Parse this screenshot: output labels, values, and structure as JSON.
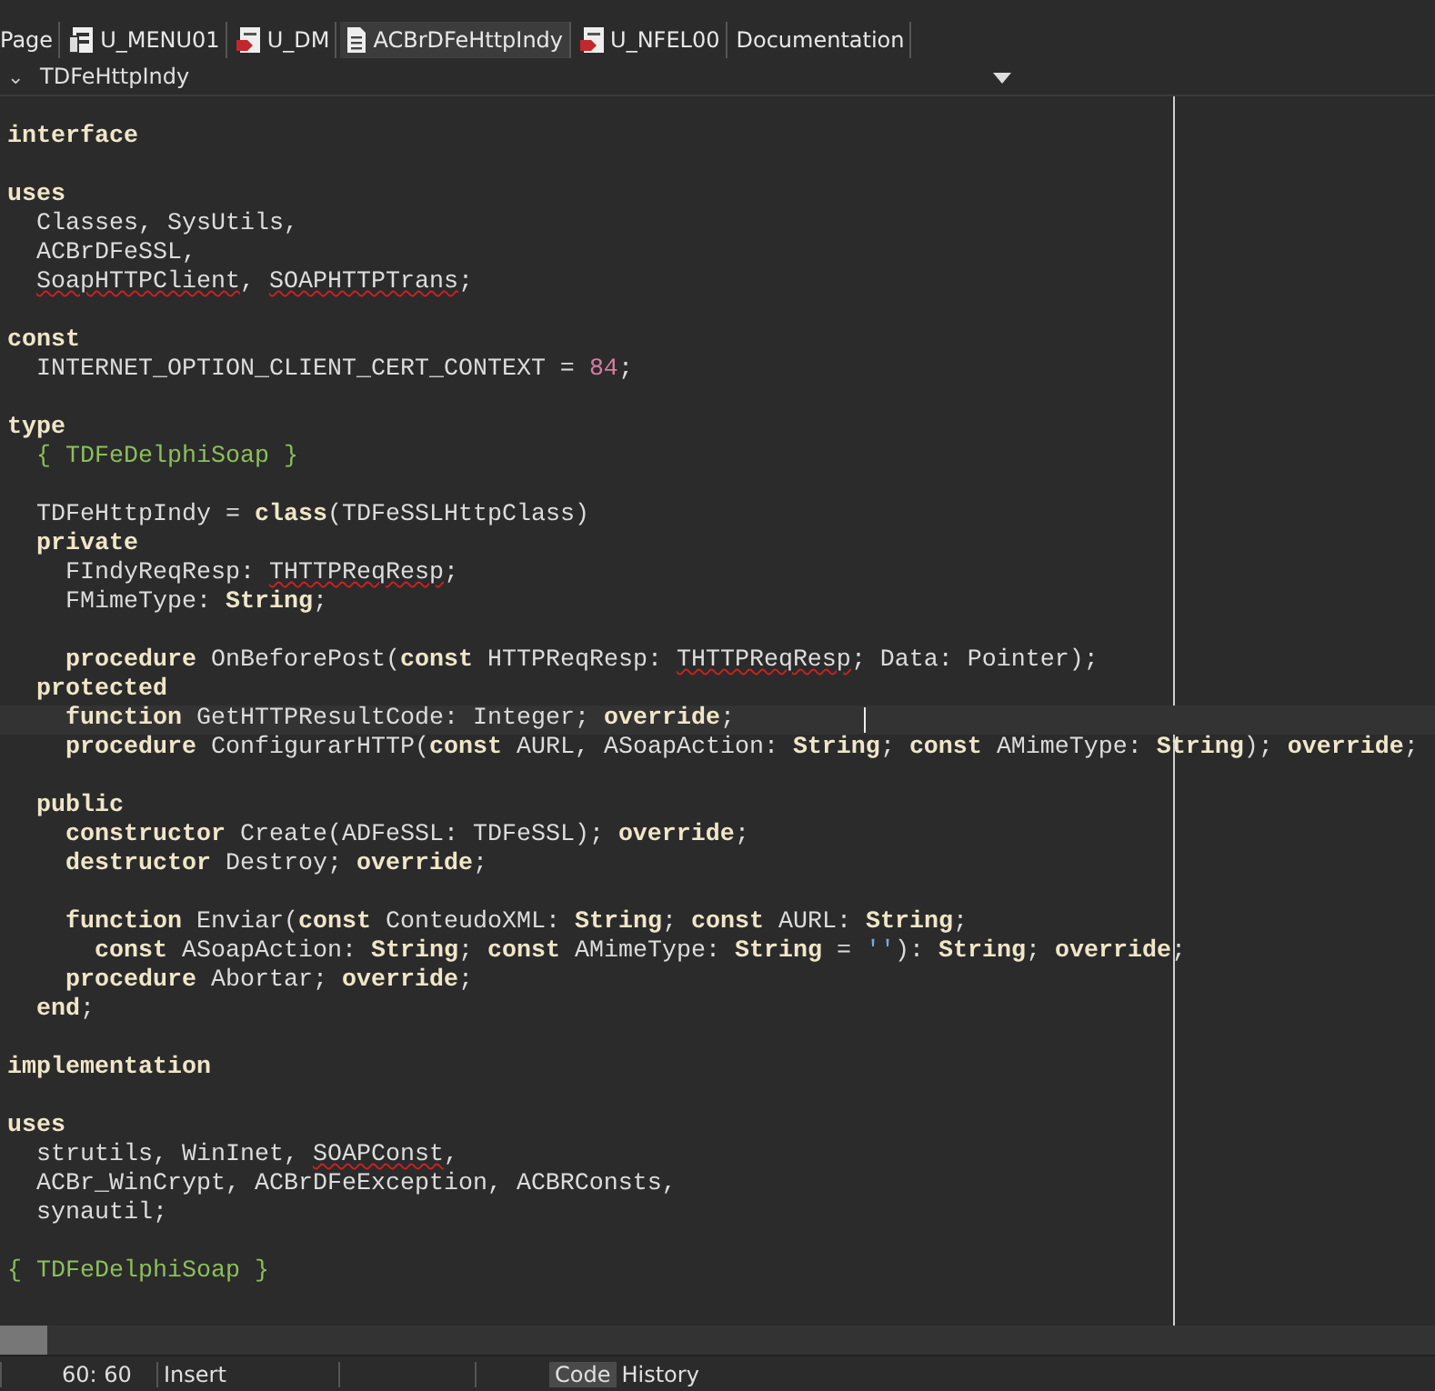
{
  "tabs": [
    {
      "label": "Page",
      "kind": "plain",
      "selected": false
    },
    {
      "label": "U_MENU01",
      "kind": "form",
      "selected": false
    },
    {
      "label": "U_DM",
      "kind": "module",
      "selected": false
    },
    {
      "label": "ACBrDFeHttpIndy",
      "kind": "unit",
      "selected": true
    },
    {
      "label": "U_NFEL00",
      "kind": "module",
      "selected": false
    },
    {
      "label": "Documentation",
      "kind": "plain",
      "selected": false
    }
  ],
  "navigator": {
    "expand_glyph": "⌄",
    "class_name": "TDFeHttpIndy"
  },
  "editor": {
    "lines": [
      {
        "kind": "code",
        "current": false,
        "segments": [
          {
            "text": "interface",
            "kind": "k"
          }
        ]
      },
      {
        "kind": "blank",
        "current": false
      },
      {
        "kind": "code",
        "current": false,
        "segments": [
          {
            "text": "uses",
            "kind": "k"
          }
        ]
      },
      {
        "kind": "code",
        "current": false,
        "segments": [
          {
            "text": "  Classes, SysUtils,",
            "kind": "t"
          }
        ]
      },
      {
        "kind": "code",
        "current": false,
        "segments": [
          {
            "text": "  ACBrDFeSSL,",
            "kind": "t"
          }
        ]
      },
      {
        "kind": "code",
        "current": false,
        "segments": [
          {
            "text": "  SoapHTTPClient",
            "kind": "e"
          },
          {
            "text": ", ",
            "kind": "t"
          },
          {
            "text": "SOAPHTTPTrans",
            "kind": "e"
          },
          {
            "text": ";",
            "kind": "t"
          }
        ]
      },
      {
        "kind": "blank",
        "current": false
      },
      {
        "kind": "code",
        "current": false,
        "segments": [
          {
            "text": "const",
            "kind": "k"
          }
        ]
      },
      {
        "kind": "code",
        "current": false,
        "segments": [
          {
            "text": "  INTERNET_OPTION_CLIENT_CERT_CONTEXT = ",
            "kind": "t"
          },
          {
            "text": "84",
            "kind": "n"
          },
          {
            "text": ";",
            "kind": "t"
          }
        ]
      },
      {
        "kind": "blank",
        "current": false
      },
      {
        "kind": "code",
        "current": false,
        "segments": [
          {
            "text": "type",
            "kind": "k"
          }
        ]
      },
      {
        "kind": "code",
        "current": false,
        "segments": [
          {
            "text": "  { TDFeDelphiSoap }",
            "kind": "c"
          }
        ]
      },
      {
        "kind": "blank",
        "current": false
      },
      {
        "kind": "code",
        "current": false,
        "segments": [
          {
            "text": "  TDFeHttpIndy = ",
            "kind": "t"
          },
          {
            "text": "class",
            "kind": "k"
          },
          {
            "text": "(TDFeSSLHttpClass)",
            "kind": "t"
          }
        ]
      },
      {
        "kind": "code",
        "current": false,
        "segments": [
          {
            "text": "  private",
            "kind": "k"
          }
        ]
      },
      {
        "kind": "code",
        "current": false,
        "segments": [
          {
            "text": "    FIndyReqResp: ",
            "kind": "t"
          },
          {
            "text": "THTTPReqResp",
            "kind": "e"
          },
          {
            "text": ";",
            "kind": "t"
          }
        ]
      },
      {
        "kind": "code",
        "current": false,
        "segments": [
          {
            "text": "    FMimeType: ",
            "kind": "t"
          },
          {
            "text": "String",
            "kind": "k"
          },
          {
            "text": ";",
            "kind": "t"
          }
        ]
      },
      {
        "kind": "blank",
        "current": false
      },
      {
        "kind": "code",
        "current": false,
        "segments": [
          {
            "text": "    procedure",
            "kind": "k"
          },
          {
            "text": " OnBeforePost(",
            "kind": "t"
          },
          {
            "text": "const",
            "kind": "k"
          },
          {
            "text": " HTTPReqResp: ",
            "kind": "t"
          },
          {
            "text": "THTTPReqResp",
            "kind": "e"
          },
          {
            "text": "; Data: Pointer);",
            "kind": "t"
          }
        ]
      },
      {
        "kind": "code",
        "current": false,
        "segments": [
          {
            "text": "  protected",
            "kind": "k"
          }
        ]
      },
      {
        "kind": "code",
        "current": true,
        "segments": [
          {
            "text": "    function",
            "kind": "k"
          },
          {
            "text": " GetHTTPResultCode: Integer; ",
            "kind": "t"
          },
          {
            "text": "override",
            "kind": "k"
          },
          {
            "text": ";",
            "kind": "t"
          }
        ]
      },
      {
        "kind": "code",
        "current": false,
        "segments": [
          {
            "text": "    procedure",
            "kind": "k"
          },
          {
            "text": " ConfigurarHTTP(",
            "kind": "t"
          },
          {
            "text": "const",
            "kind": "k"
          },
          {
            "text": " AURL, ASoapAction: ",
            "kind": "t"
          },
          {
            "text": "String",
            "kind": "k"
          },
          {
            "text": "; ",
            "kind": "t"
          },
          {
            "text": "const",
            "kind": "k"
          },
          {
            "text": " AMimeType: ",
            "kind": "t"
          },
          {
            "text": "String",
            "kind": "k"
          },
          {
            "text": "); ",
            "kind": "t"
          },
          {
            "text": "override",
            "kind": "k"
          },
          {
            "text": ";",
            "kind": "t"
          }
        ]
      },
      {
        "kind": "blank",
        "current": false
      },
      {
        "kind": "code",
        "current": false,
        "segments": [
          {
            "text": "  public",
            "kind": "k"
          }
        ]
      },
      {
        "kind": "code",
        "current": false,
        "segments": [
          {
            "text": "    constructor",
            "kind": "k"
          },
          {
            "text": " Create(ADFeSSL: TDFeSSL); ",
            "kind": "t"
          },
          {
            "text": "override",
            "kind": "k"
          },
          {
            "text": ";",
            "kind": "t"
          }
        ]
      },
      {
        "kind": "code",
        "current": false,
        "segments": [
          {
            "text": "    destructor",
            "kind": "k"
          },
          {
            "text": " Destroy; ",
            "kind": "t"
          },
          {
            "text": "override",
            "kind": "k"
          },
          {
            "text": ";",
            "kind": "t"
          }
        ]
      },
      {
        "kind": "blank",
        "current": false
      },
      {
        "kind": "code",
        "current": false,
        "segments": [
          {
            "text": "    function",
            "kind": "k"
          },
          {
            "text": " Enviar(",
            "kind": "t"
          },
          {
            "text": "const",
            "kind": "k"
          },
          {
            "text": " ConteudoXML: ",
            "kind": "t"
          },
          {
            "text": "String",
            "kind": "k"
          },
          {
            "text": "; ",
            "kind": "t"
          },
          {
            "text": "const",
            "kind": "k"
          },
          {
            "text": " AURL: ",
            "kind": "t"
          },
          {
            "text": "String",
            "kind": "k"
          },
          {
            "text": ";",
            "kind": "t"
          }
        ]
      },
      {
        "kind": "code",
        "current": false,
        "segments": [
          {
            "text": "      const",
            "kind": "k"
          },
          {
            "text": " ASoapAction: ",
            "kind": "t"
          },
          {
            "text": "String",
            "kind": "k"
          },
          {
            "text": "; ",
            "kind": "t"
          },
          {
            "text": "const",
            "kind": "k"
          },
          {
            "text": " AMimeType: ",
            "kind": "t"
          },
          {
            "text": "String",
            "kind": "k"
          },
          {
            "text": " = ",
            "kind": "t"
          },
          {
            "text": "''",
            "kind": "s"
          },
          {
            "text": "): ",
            "kind": "t"
          },
          {
            "text": "String",
            "kind": "k"
          },
          {
            "text": "; ",
            "kind": "t"
          },
          {
            "text": "override",
            "kind": "k"
          },
          {
            "text": ";",
            "kind": "t"
          }
        ]
      },
      {
        "kind": "code",
        "current": false,
        "segments": [
          {
            "text": "    procedure",
            "kind": "k"
          },
          {
            "text": " Abortar; ",
            "kind": "t"
          },
          {
            "text": "override",
            "kind": "k"
          },
          {
            "text": ";",
            "kind": "t"
          }
        ]
      },
      {
        "kind": "code",
        "current": false,
        "segments": [
          {
            "text": "  end",
            "kind": "k"
          },
          {
            "text": ";",
            "kind": "t"
          }
        ]
      },
      {
        "kind": "blank",
        "current": false
      },
      {
        "kind": "code",
        "current": false,
        "segments": [
          {
            "text": "implementation",
            "kind": "k"
          }
        ]
      },
      {
        "kind": "blank",
        "current": false
      },
      {
        "kind": "code",
        "current": false,
        "segments": [
          {
            "text": "uses",
            "kind": "k"
          }
        ]
      },
      {
        "kind": "code",
        "current": false,
        "segments": [
          {
            "text": "  strutils, WinInet, ",
            "kind": "t"
          },
          {
            "text": "SOAPConst",
            "kind": "e"
          },
          {
            "text": ",",
            "kind": "t"
          }
        ]
      },
      {
        "kind": "code",
        "current": false,
        "segments": [
          {
            "text": "  ACBr_WinCrypt, ACBrDFeException, ACBRConsts,",
            "kind": "t"
          }
        ]
      },
      {
        "kind": "code",
        "current": false,
        "segments": [
          {
            "text": "  synautil;",
            "kind": "t"
          }
        ]
      },
      {
        "kind": "blank",
        "current": false
      },
      {
        "kind": "code",
        "current": false,
        "segments": [
          {
            "text": "{ TDFeDelphiSoap }",
            "kind": "c"
          }
        ]
      }
    ]
  },
  "status_bar": {
    "position": "60: 60",
    "mode": "Insert",
    "view_tabs": [
      {
        "label": "Code",
        "selected": true
      },
      {
        "label": "History",
        "selected": false
      }
    ]
  }
}
